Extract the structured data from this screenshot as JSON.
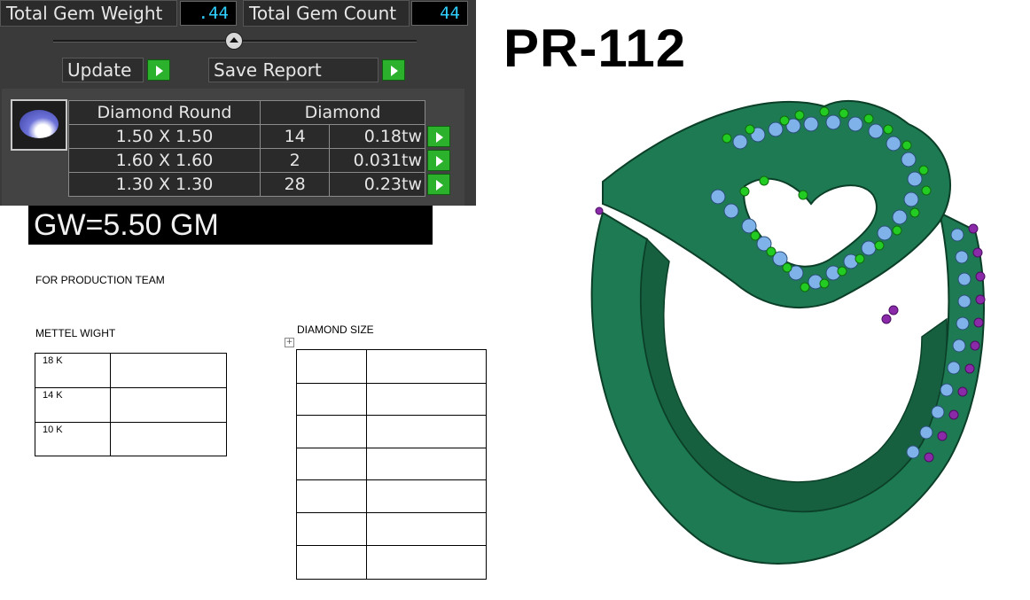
{
  "gem_panel": {
    "total_weight_label": "Total Gem Weight",
    "total_weight_value": ".44",
    "total_count_label": "Total Gem Count",
    "total_count_value": "44",
    "update_label": "Update",
    "save_report_label": "Save Report",
    "table_headers": [
      "Diamond Round",
      "Diamond"
    ],
    "rows": [
      {
        "size": "1.50 X 1.50",
        "count": "14",
        "weight": "0.18tw"
      },
      {
        "size": "1.60 X 1.60",
        "count": "2",
        "weight": "0.031tw"
      },
      {
        "size": "1.30 X 1.30",
        "count": "28",
        "weight": "0.23tw"
      }
    ]
  },
  "gross_weight": "GW=5.50 GM",
  "production": {
    "heading": "FOR PRODUCTION TEAM",
    "metal_heading": "METTEL WIGHT",
    "metal_rows": [
      "18 K",
      "14 K",
      "10 K"
    ],
    "diamond_heading": "DIAMOND SIZE",
    "diamond_rows": 7
  },
  "product_code": "PR-112",
  "colors": {
    "ring_metal": "#1e7a52",
    "ring_dark": "#0d4a30",
    "stone_setting": "#7fb2e8",
    "prong_green": "#22cc22",
    "prong_purple": "#8a2aa8",
    "value_cyan": "#2fd0ff",
    "go_button": "#2bb12b"
  }
}
